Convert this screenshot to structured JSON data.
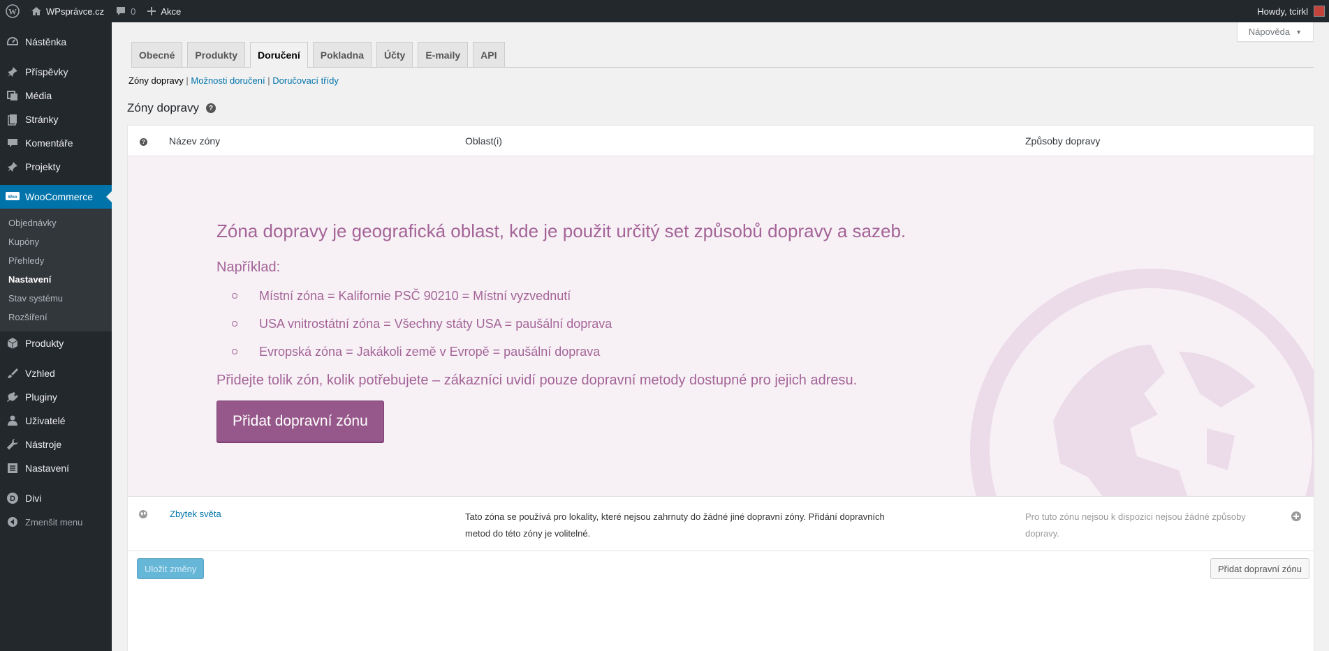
{
  "adminbar": {
    "site_name": "WPsprávce.cz",
    "comments_count": "0",
    "new_label": "Akce",
    "greeting": "Howdy, tcirkl"
  },
  "sidebar": {
    "items": [
      {
        "label": "Nástěnka",
        "icon": "dashboard-icon"
      },
      {
        "label": "Příspěvky",
        "icon": "pin-icon"
      },
      {
        "label": "Média",
        "icon": "media-icon"
      },
      {
        "label": "Stránky",
        "icon": "pages-icon"
      },
      {
        "label": "Komentáře",
        "icon": "comment-icon"
      },
      {
        "label": "Projekty",
        "icon": "pin-icon"
      },
      {
        "label": "WooCommerce",
        "icon": "woo-icon"
      },
      {
        "label": "Produkty",
        "icon": "box-icon"
      },
      {
        "label": "Vzhled",
        "icon": "brush-icon"
      },
      {
        "label": "Pluginy",
        "icon": "plug-icon"
      },
      {
        "label": "Uživatelé",
        "icon": "user-icon"
      },
      {
        "label": "Nástroje",
        "icon": "wrench-icon"
      },
      {
        "label": "Nastavení",
        "icon": "settings-icon"
      },
      {
        "label": "Divi",
        "icon": "divi-icon"
      }
    ],
    "submenu": [
      "Objednávky",
      "Kupóny",
      "Přehledy",
      "Nastavení",
      "Stav systému",
      "Rozšíření"
    ],
    "collapse_label": "Zmenšit menu"
  },
  "help_tab": "Nápověda",
  "tabs": [
    "Obecné",
    "Produkty",
    "Doručení",
    "Pokladna",
    "Účty",
    "E-maily",
    "API"
  ],
  "subsub": {
    "current": "Zóny dopravy",
    "link1": "Možnosti doručení",
    "link2": "Doručovací třídy"
  },
  "page_title": "Zóny dopravy",
  "table": {
    "col_name": "Název zóny",
    "col_region": "Oblast(i)",
    "col_methods": "Způsoby dopravy"
  },
  "blank": {
    "headline": "Zóna dopravy je geografická oblast, kde je použit určitý set způsobů dopravy a sazeb.",
    "example_label": "Například:",
    "examples": [
      "Místní zóna = Kalifornie PSČ 90210 = Místní vyzvednutí",
      "USA vnitrostátní zóna = Všechny státy USA = paušální doprava",
      "Evropská zóna = Jakákoli země v Evropě = paušální doprava"
    ],
    "add_text": "Přidejte tolik zón, kolik potřebujete – zákazníci uvidí pouze dopravní metody dostupné pro jejich adresu.",
    "button": "Přidat dopravní zónu"
  },
  "rest_of_world": {
    "name": "Zbytek světa",
    "description": "Tato zóna se používá pro lokality, které nejsou zahrnuty do žádné jiné dopravní zóny. Přidání dopravních metod do této zóny je volitelné.",
    "methods": "Pro tuto zónu nejsou k dispozici nejsou žádné způsoby dopravy."
  },
  "footer": {
    "save": "Uložit změny",
    "add_zone": "Přidat dopravní zónu"
  },
  "colors": {
    "woo_purple": "#96588a",
    "wp_blue": "#0073aa",
    "admin_dark": "#23282d"
  }
}
